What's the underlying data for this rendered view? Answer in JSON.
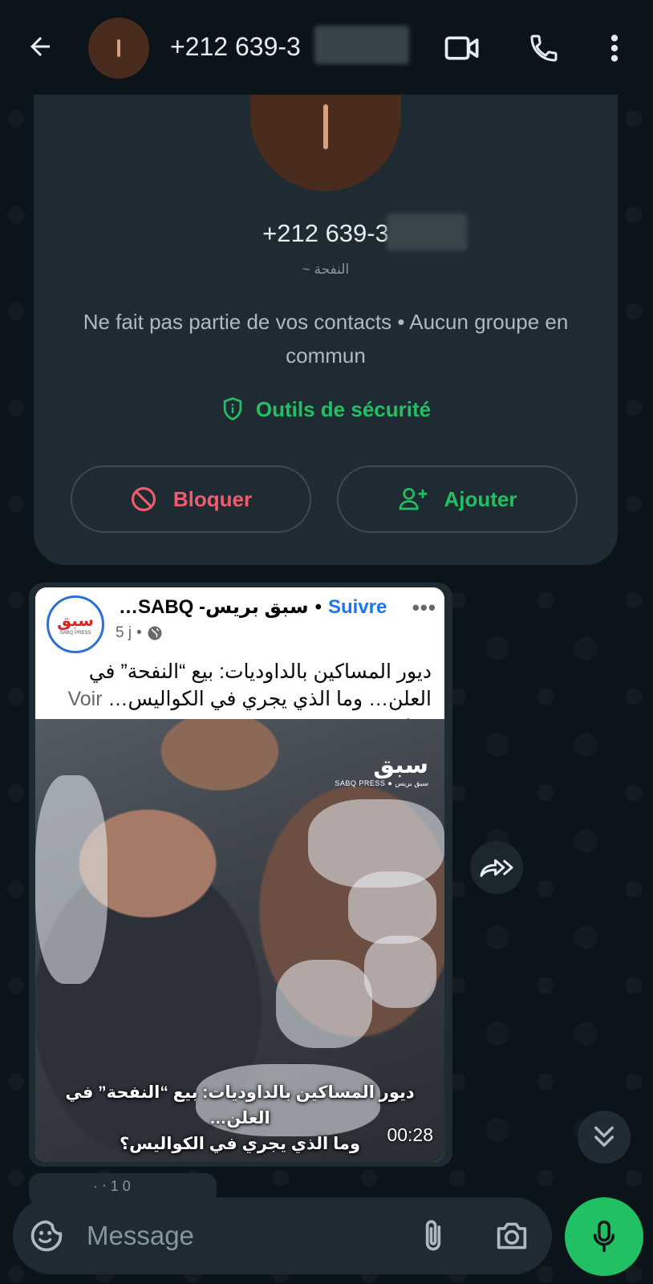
{
  "header": {
    "title": "+212 639-3"
  },
  "info_card": {
    "phone": "+212 639-3",
    "push_name": "~ النفحة",
    "description": "Ne fait pas partie de vos contacts • Aucun groupe en commun",
    "security_label": "Outils de sécurité",
    "block_label": "Bloquer",
    "add_label": "Ajouter"
  },
  "post": {
    "page_name": "…SABQ -سبق بريس",
    "separator": "•",
    "follow_label": "Suivre",
    "more": "•••",
    "age": "5 j",
    "meta_dot": "•",
    "logo_text": "سبق",
    "logo_sub": "SABQ PRESS",
    "text": "ديور المساكين بالداوديات: بيع “النفحة” في العلن… وما الذي يجري في الكواليس… ",
    "voir_plus": "Voir plus",
    "watermark": "سبق",
    "watermark_sub": "SABQ PRESS ● سبق بريس",
    "caption_line1": "ديور المساكين بالداوديات: بيع “النفحة” في العلن…",
    "caption_line2": "وما الذي يجري في الكواليس؟",
    "duration": "00:28"
  },
  "next_message": {
    "preview": "· ‧ 1 0"
  },
  "composer": {
    "placeholder": "Message"
  },
  "colors": {
    "background": "#0b141a",
    "card": "#1f2b32",
    "green": "#21c063",
    "red": "#f15c6d",
    "link_blue": "#1877f2"
  }
}
